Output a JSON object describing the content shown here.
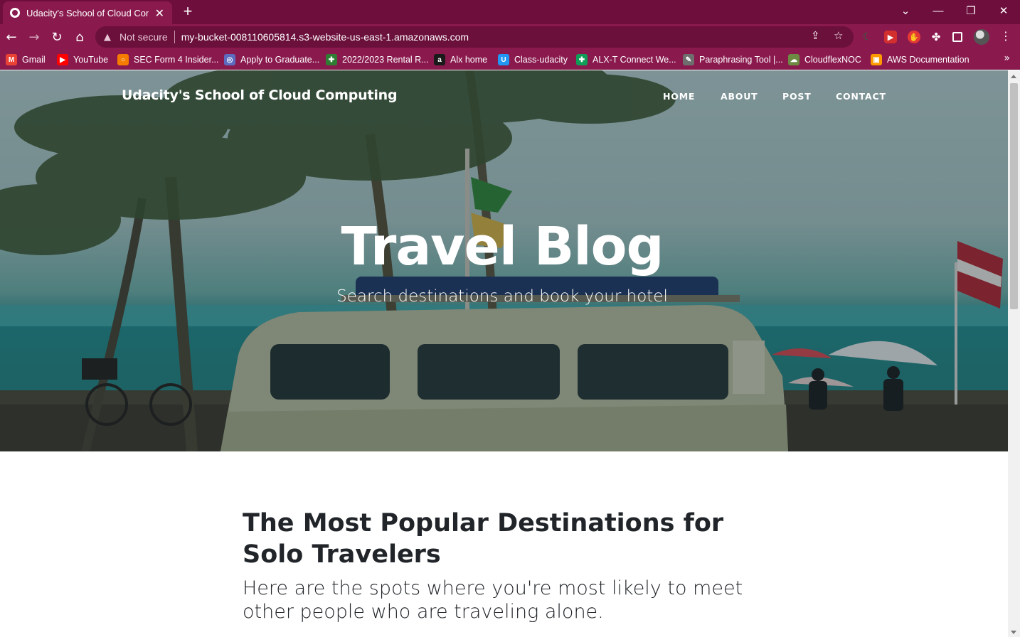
{
  "browser": {
    "tab": {
      "title": "Udacity's School of Cloud Computing",
      "close_glyph": "✕"
    },
    "new_tab_glyph": "+",
    "window_controls": {
      "tab_search": "⌄",
      "minimize": "—",
      "restore": "❐",
      "close": "✕"
    },
    "nav": {
      "back": "←",
      "forward": "→",
      "reload": "↻",
      "home": "⌂"
    },
    "omnibox": {
      "security_label": "Not secure",
      "url": "my-bucket-008110605814.s3-website-us-east-1.amazonaws.com"
    },
    "bookmarks": [
      {
        "label": "Gmail",
        "icon": "gmail-icon",
        "color": "#ea4335",
        "glyph": "M"
      },
      {
        "label": "YouTube",
        "icon": "youtube-icon",
        "color": "#ff0000",
        "glyph": "▶"
      },
      {
        "label": "SEC Form 4 Insider...",
        "icon": "sec-icon",
        "color": "#f57c00",
        "glyph": "○"
      },
      {
        "label": "Apply to Graduate...",
        "icon": "graduate-icon",
        "color": "#5c6bc0",
        "glyph": "◎"
      },
      {
        "label": "2022/2023 Rental R...",
        "icon": "rental-icon",
        "color": "#2e7d32",
        "glyph": "✚"
      },
      {
        "label": "Alx home",
        "icon": "alx-icon",
        "color": "#1a1a1a",
        "glyph": "a"
      },
      {
        "label": "Class-udacity",
        "icon": "udacity-icon",
        "color": "#2196f3",
        "glyph": "U"
      },
      {
        "label": "ALX-T Connect We...",
        "icon": "connect-icon",
        "color": "#0f9d58",
        "glyph": "✚"
      },
      {
        "label": "Paraphrasing Tool |...",
        "icon": "quill-icon",
        "color": "#6e6e6e",
        "glyph": "✎"
      },
      {
        "label": "CloudflexNOC",
        "icon": "cloudflex-icon",
        "color": "#6d8a43",
        "glyph": "☁"
      },
      {
        "label": "AWS Documentation",
        "icon": "aws-icon",
        "color": "#ff9900",
        "glyph": "▣"
      }
    ],
    "bookmarks_more": "»"
  },
  "site": {
    "brand": "Udacity's School of Cloud Computing",
    "nav": [
      "HOME",
      "ABOUT",
      "POST",
      "CONTACT"
    ],
    "hero_title": "Travel Blog",
    "hero_subtitle": "Search destinations and book your hotel",
    "post_title": "The Most Popular Destinations for Solo Travelers",
    "post_subtitle": "Here are the spots where you're most likely to meet other people who are traveling alone."
  },
  "colors": {
    "tab_bar": "#6e0e3c",
    "toolbar": "#8a1a4e",
    "heading_text": "#212529"
  }
}
